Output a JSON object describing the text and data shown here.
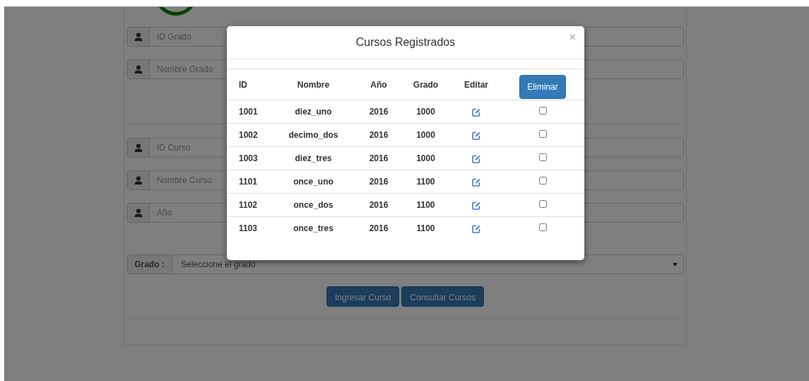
{
  "grado_fields": [
    {
      "placeholder": "ID Grado"
    },
    {
      "placeholder": "Nombre Grado"
    }
  ],
  "curso_fields": [
    {
      "placeholder": "ID Curso"
    },
    {
      "placeholder": "Nombre Curso"
    },
    {
      "placeholder": "Año"
    }
  ],
  "grado_select": {
    "label": "Grado :",
    "value": "Seleccione el grado"
  },
  "buttons": [
    "Ingresar Curso",
    "Consultar Cursos"
  ],
  "modal": {
    "title": "Cursos Registrados",
    "close": "×",
    "columns": [
      "ID",
      "Nombre",
      "Año",
      "Grado",
      "Editar"
    ],
    "delete_button": "Eliminar",
    "rows": [
      {
        "id": "1001",
        "nombre": "diez_uno",
        "anio": "2016",
        "grado": "1000",
        "checked": false
      },
      {
        "id": "1002",
        "nombre": "decimo_dos",
        "anio": "2016",
        "grado": "1000",
        "checked": false
      },
      {
        "id": "1003",
        "nombre": "diez_tres",
        "anio": "2016",
        "grado": "1000",
        "checked": false
      },
      {
        "id": "1101",
        "nombre": "once_uno",
        "anio": "2016",
        "grado": "1100",
        "checked": false
      },
      {
        "id": "1102",
        "nombre": "once_dos",
        "anio": "2016",
        "grado": "1100",
        "checked": false
      },
      {
        "id": "1103",
        "nombre": "once_tres",
        "anio": "2016",
        "grado": "1100",
        "checked": false
      }
    ]
  }
}
